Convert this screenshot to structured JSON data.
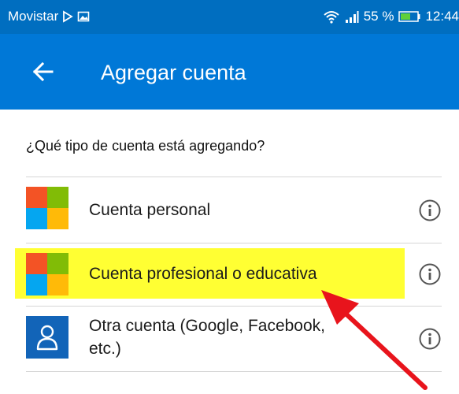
{
  "status_bar": {
    "carrier": "Movistar",
    "battery": "55 %",
    "time": "12:44",
    "icons": [
      "play-store-notification-icon",
      "gallery-notification-icon",
      "wifi-icon",
      "signal-icon",
      "battery-icon"
    ]
  },
  "app_bar": {
    "title": "Agregar cuenta",
    "back_icon": "arrow-left-icon"
  },
  "prompt": "¿Qué tipo de cuenta está agregando?",
  "options": [
    {
      "label": "Cuenta personal",
      "icon": "microsoft-logo-icon",
      "info_icon": "info-icon"
    },
    {
      "label": "Cuenta profesional o educativa",
      "icon": "microsoft-logo-icon",
      "info_icon": "info-icon",
      "highlighted": true
    },
    {
      "label": "Otra cuenta (Google, Facebook, etc.)",
      "label_lines": [
        "Otra cuenta (Google, Facebook,",
        "etc.)"
      ],
      "icon": "person-icon",
      "info_icon": "info-icon"
    }
  ],
  "colors": {
    "status_bar": "#006ec0",
    "app_bar": "#0078d7",
    "highlight": "#ffff33",
    "annotation_arrow": "#e8141c",
    "person_icon_bg": "#1264b8"
  }
}
